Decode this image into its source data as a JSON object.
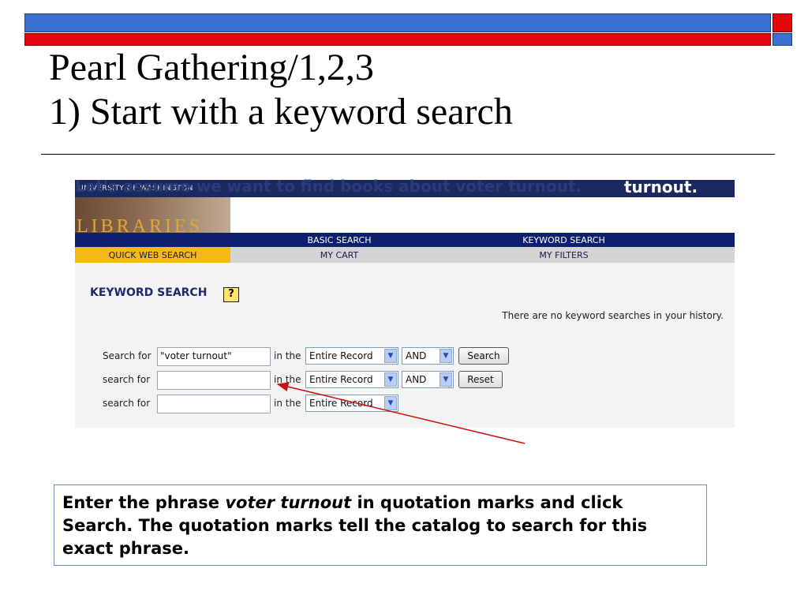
{
  "slide": {
    "title_line1": "Pearl Gathering/1,2,3",
    "title_line2": "1) Start with a keyword search",
    "caption": "Let's assume we want to find books about voter turnout.",
    "callout": {
      "part1": "Enter the phrase ",
      "emphasis": "voter turnout",
      "part2": " in quotation marks  and click Search. The quotation marks tell the catalog to search for this exact phrase."
    },
    "colors": {
      "bar_blue": "#3b6fd1",
      "bar_red": "#e3080f",
      "arrow": "#cc1111"
    }
  },
  "screenshot": {
    "university_name": "UNIVERSITY OF WASHINGTON",
    "logo_text": "LIBRARIES",
    "nav_top": [
      "BASIC SEARCH",
      "KEYWORD SEARCH"
    ],
    "nav_bottom": [
      "QUICK WEB SEARCH",
      "MY CART",
      "MY FILTERS"
    ],
    "heading": "KEYWORD SEARCH",
    "help_symbol": "?",
    "history_message": "There are no keyword searches in your history.",
    "rows": [
      {
        "label": "Search for",
        "value": "\"voter turnout\"",
        "in_the": "in the",
        "field": "Entire Record",
        "operator": "AND",
        "button": "Search"
      },
      {
        "label": "search for",
        "value": "",
        "in_the": "in the",
        "field": "Entire Record",
        "operator": "AND",
        "button": "Reset"
      },
      {
        "label": "search for",
        "value": "",
        "in_the": "in the",
        "field": "Entire Record"
      }
    ]
  }
}
